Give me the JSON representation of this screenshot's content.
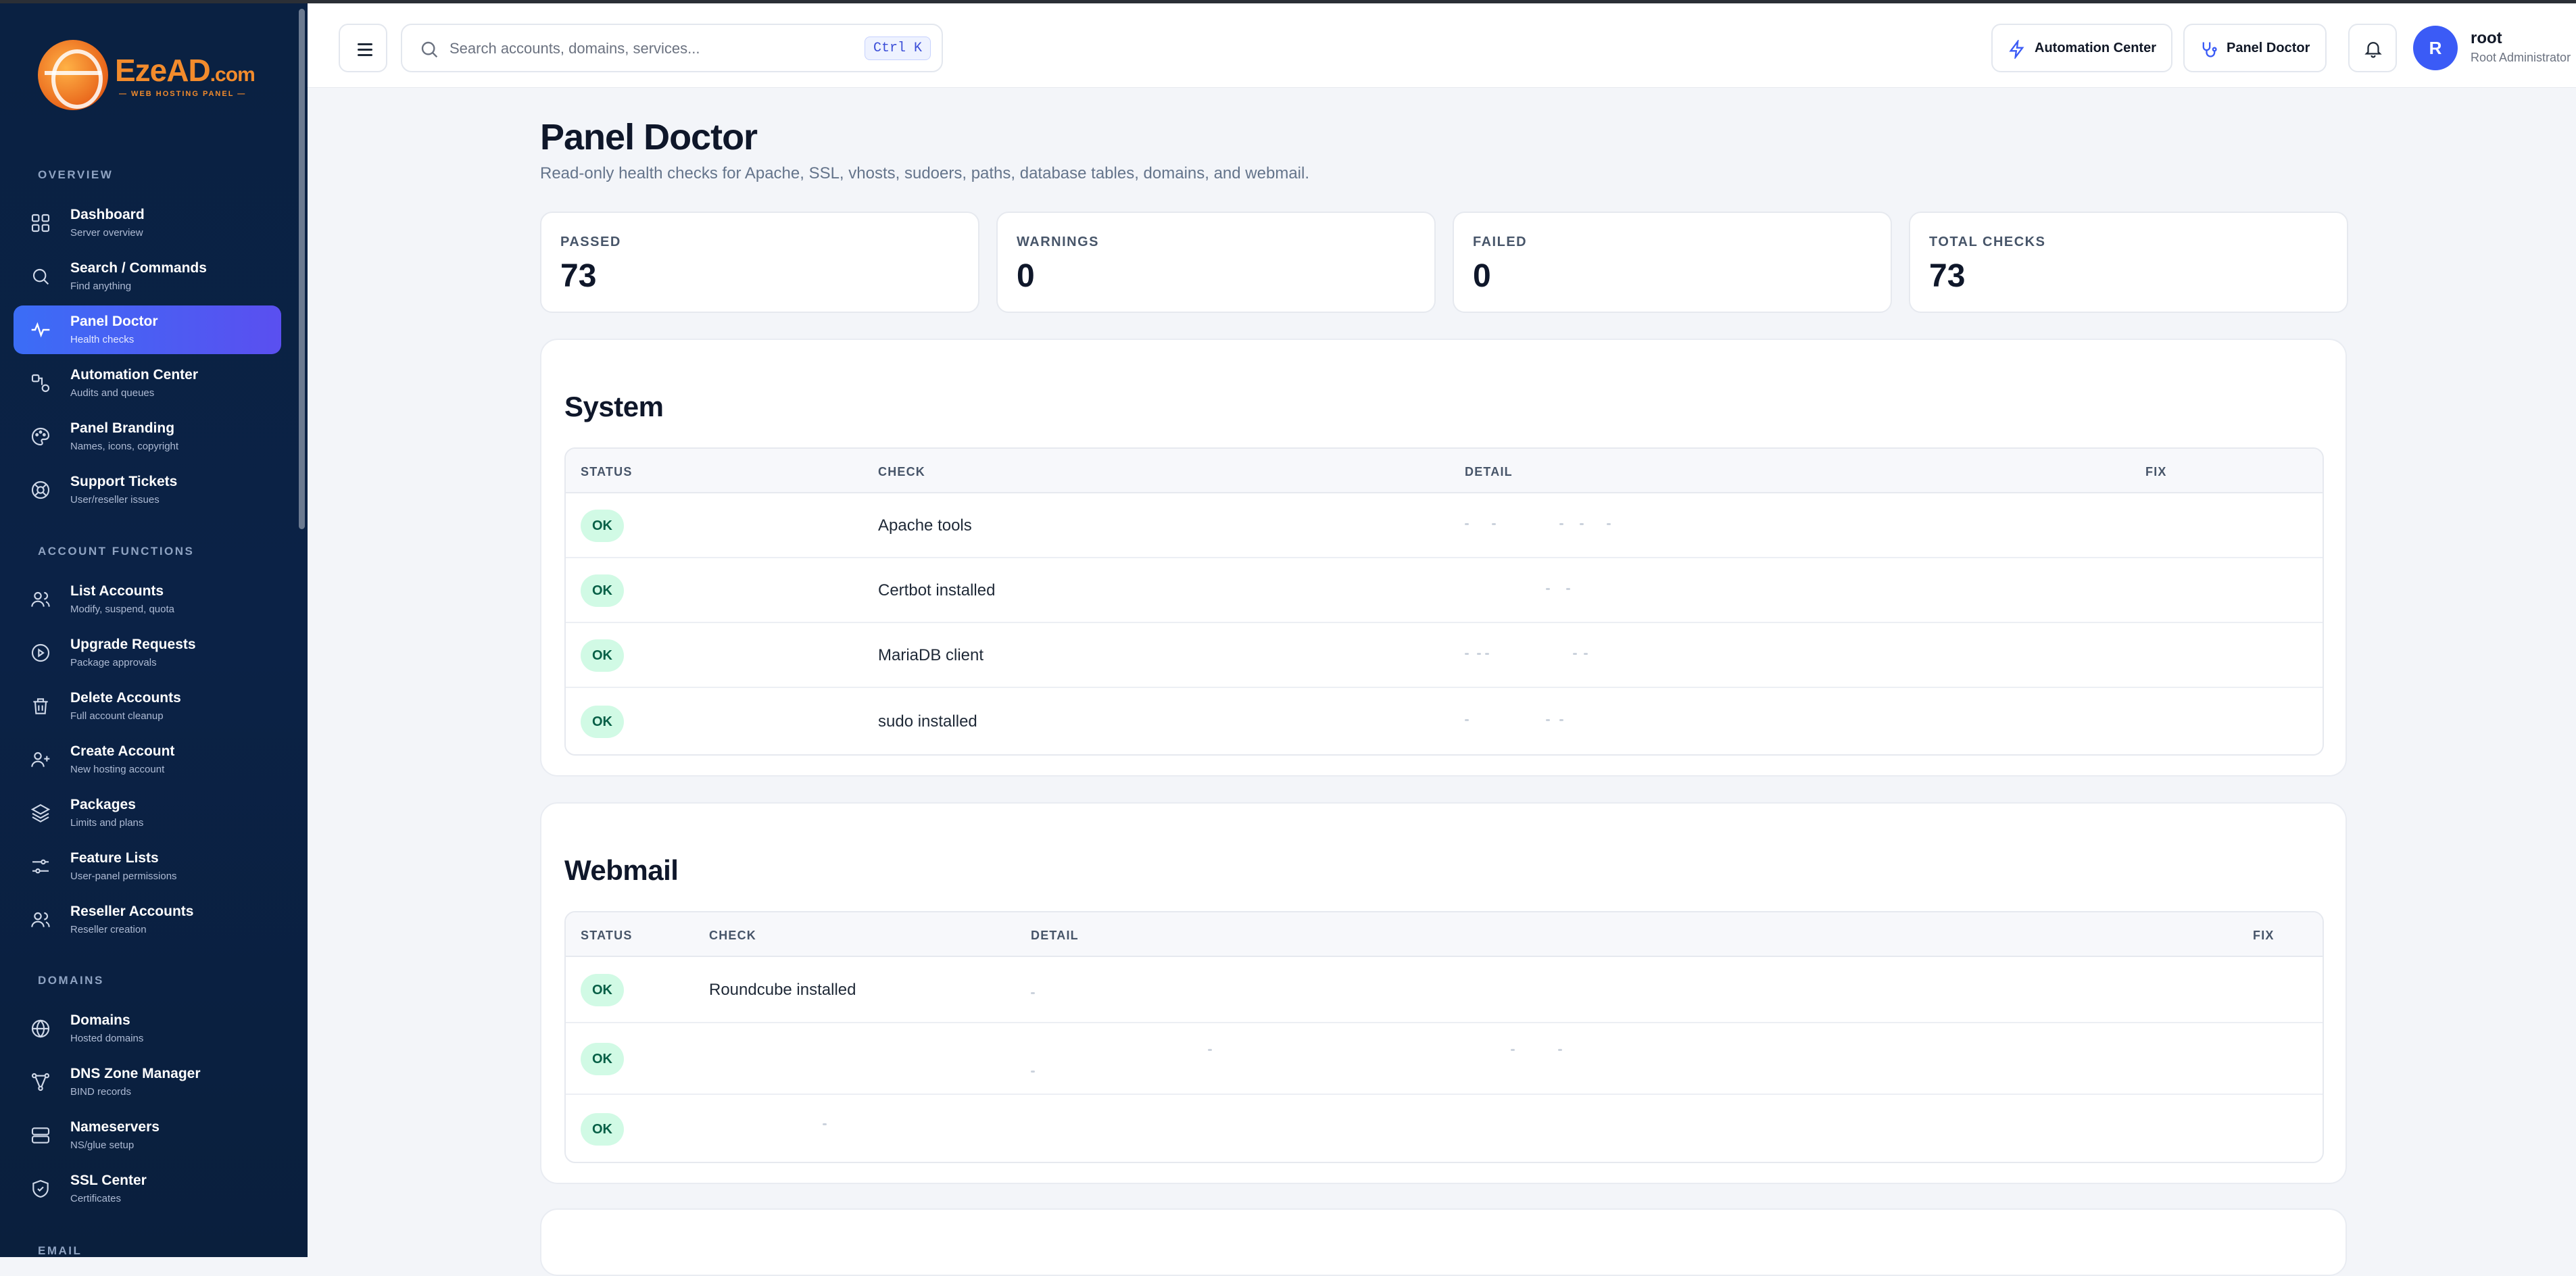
{
  "logo": {
    "name": "EzeAD",
    "suffix": ".com",
    "tagline": "— WEB HOSTING PANEL —"
  },
  "sidebar": {
    "sections": [
      {
        "label": "OVERVIEW"
      },
      {
        "label": "ACCOUNT FUNCTIONS"
      },
      {
        "label": "DOMAINS"
      },
      {
        "label": "EMAIL"
      }
    ],
    "items": [
      {
        "title": "Dashboard",
        "sub": "Server overview",
        "icon": "grid-icon"
      },
      {
        "title": "Search / Commands",
        "sub": "Find anything",
        "icon": "search-icon"
      },
      {
        "title": "Panel Doctor",
        "sub": "Health checks",
        "icon": "pulse-icon"
      },
      {
        "title": "Automation Center",
        "sub": "Audits and queues",
        "icon": "workflow-icon"
      },
      {
        "title": "Panel Branding",
        "sub": "Names, icons, copyright",
        "icon": "palette-icon"
      },
      {
        "title": "Support Tickets",
        "sub": "User/reseller issues",
        "icon": "lifebuoy-icon"
      },
      {
        "title": "List Accounts",
        "sub": "Modify, suspend, quota",
        "icon": "users-icon"
      },
      {
        "title": "Upgrade Requests",
        "sub": "Package approvals",
        "icon": "play-circle-icon"
      },
      {
        "title": "Delete Accounts",
        "sub": "Full account cleanup",
        "icon": "trash-icon"
      },
      {
        "title": "Create Account",
        "sub": "New hosting account",
        "icon": "user-plus-icon"
      },
      {
        "title": "Packages",
        "sub": "Limits and plans",
        "icon": "layers-icon"
      },
      {
        "title": "Feature Lists",
        "sub": "User-panel permissions",
        "icon": "sliders-icon"
      },
      {
        "title": "Reseller Accounts",
        "sub": "Reseller creation",
        "icon": "users-icon"
      },
      {
        "title": "Domains",
        "sub": "Hosted domains",
        "icon": "globe-icon"
      },
      {
        "title": "DNS Zone Manager",
        "sub": "BIND records",
        "icon": "network-icon"
      },
      {
        "title": "Nameservers",
        "sub": "NS/glue setup",
        "icon": "server-icon"
      },
      {
        "title": "SSL Center",
        "sub": "Certificates",
        "icon": "shield-icon"
      }
    ]
  },
  "header": {
    "search_placeholder": "Search accounts, domains, services...",
    "search_shortcut": "Ctrl K",
    "automation_label": "Automation Center",
    "doctor_label": "Panel Doctor",
    "avatar_initial": "R",
    "user_name": "root",
    "user_role": "Root Administrator"
  },
  "page": {
    "title": "Panel Doctor",
    "subtitle": "Read-only health checks for Apache, SSL, vhosts, sudoers, paths, database tables, domains, and webmail."
  },
  "stats": [
    {
      "label": "PASSED",
      "value": "73"
    },
    {
      "label": "WARNINGS",
      "value": "0"
    },
    {
      "label": "FAILED",
      "value": "0"
    },
    {
      "label": "TOTAL CHECKS",
      "value": "73"
    }
  ],
  "sections": [
    {
      "title": "System",
      "columns": [
        "STATUS",
        "CHECK",
        "DETAIL",
        "FIX"
      ],
      "rows": [
        {
          "status": "OK",
          "check": "Apache tools"
        },
        {
          "status": "OK",
          "check": "Certbot installed"
        },
        {
          "status": "OK",
          "check": "MariaDB client"
        },
        {
          "status": "OK",
          "check": "sudo installed"
        }
      ]
    },
    {
      "title": "Webmail",
      "columns": [
        "STATUS",
        "CHECK",
        "DETAIL",
        "FIX"
      ],
      "rows": [
        {
          "status": "OK",
          "check": "Roundcube installed"
        },
        {
          "status": "OK",
          "check": ""
        },
        {
          "status": "OK",
          "check": ""
        }
      ]
    }
  ],
  "colors": {
    "accent": "#3b6df6",
    "sidebar_bg": "#0a2142",
    "ok_bg": "#d1fae5",
    "ok_text": "#065f46",
    "brand_orange": "#f28b2c"
  }
}
